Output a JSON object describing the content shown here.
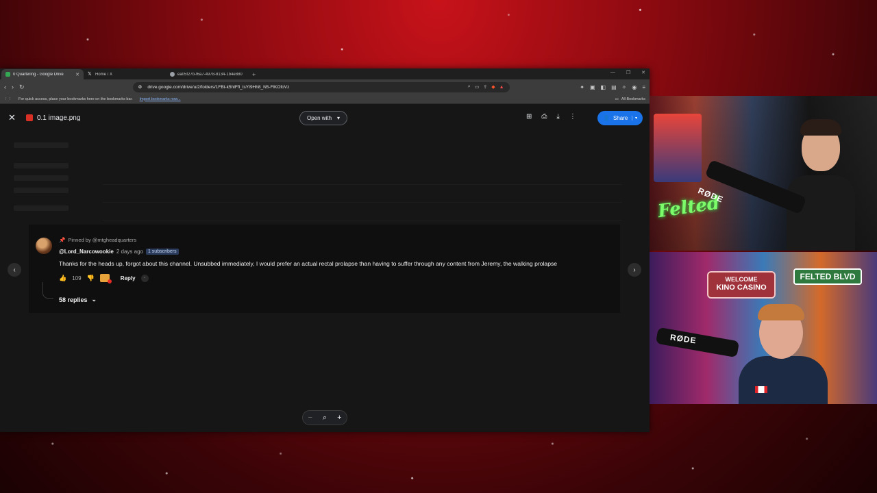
{
  "browser": {
    "tabs": [
      {
        "label": "0 Quartering - Google Drive",
        "active": true,
        "favicon_color": "#34a853"
      },
      {
        "label": "Home / X",
        "active": false,
        "favicon_color": "#ffffff"
      },
      {
        "label": "ea05f27b-f6a7-4978-8134-1b4e880",
        "active": false,
        "favicon_color": "#9aa0a6"
      }
    ],
    "url": "drive.google.com/drive/u/2/folders/1FBt-k5hIFfl_tsYI9Hh8_N5-FlKOfoVz",
    "bookmarks_hint": "For quick access, place your bookmarks here on the bookmarks bar.",
    "import_link": "Import bookmarks now...",
    "all_bookmarks": "All Bookmarks"
  },
  "viewer": {
    "file_name": "0.1 image.png",
    "open_with": "Open with",
    "share": "Share",
    "accent": "#1a73e8"
  },
  "comment": {
    "pinned_by": "Pinned by @mtgheadquarters",
    "author": "@Lord_Narcowookie",
    "time_ago": "2 days ago",
    "subscribers": "1 subscribers",
    "text": "Thanks for the heads up, forgot about this channel. Unsubbed immediately, I would prefer an actual rectal prolapse than having to suffer through any content from Jeremy, the walking prolapse",
    "likes": "109",
    "reply_label": "Reply",
    "replies": "58 replies"
  },
  "overlay": {
    "cam_top_sign": "Felted",
    "cam_bottom_sign_top": "WELCOME",
    "cam_bottom_sign_main": "KINO CASINO",
    "cam_bottom_blvd": "FELTED BLVD",
    "mic_brand": "RØDE"
  }
}
